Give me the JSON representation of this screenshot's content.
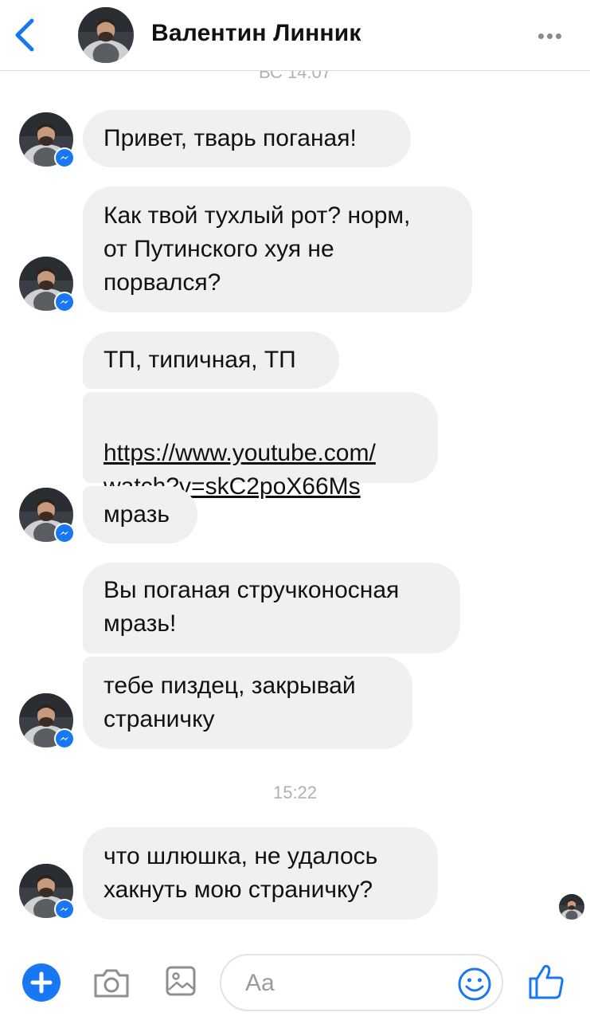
{
  "header": {
    "title": "Валентин Линник",
    "back_icon": "chevron-left-icon",
    "more_icon": "more-dots-icon"
  },
  "colors": {
    "accent": "#1877f2",
    "bubble_bg": "#f0f0f0",
    "timestamp": "#b0b0b5"
  },
  "conversation": {
    "timestamp_top": "ВС 14:07",
    "timestamp_mid": "15:22",
    "messages": [
      {
        "text": "Привет, тварь поганая!"
      },
      {
        "text": "Как твой тухлый рот? норм,\nот Путинского хуя не\nпорвался?"
      },
      {
        "text": "ТП, типичная, ТП"
      },
      {
        "text": "https://www.youtube.com/\nwatch?v=skC2poX66Ms"
      },
      {
        "text": "мразь"
      },
      {
        "text": "Вы поганая стручконосная\nмразь!"
      },
      {
        "text": "тебе пиздец, закрывай\nстраничку"
      },
      {
        "text": "что  шлюшка, не удалось\nхакнуть мою страничку?"
      }
    ]
  },
  "composer": {
    "placeholder": "Aa",
    "icons": [
      "plus-icon",
      "camera-icon",
      "image-icon",
      "emoji-icon",
      "thumbs-up-icon"
    ]
  }
}
